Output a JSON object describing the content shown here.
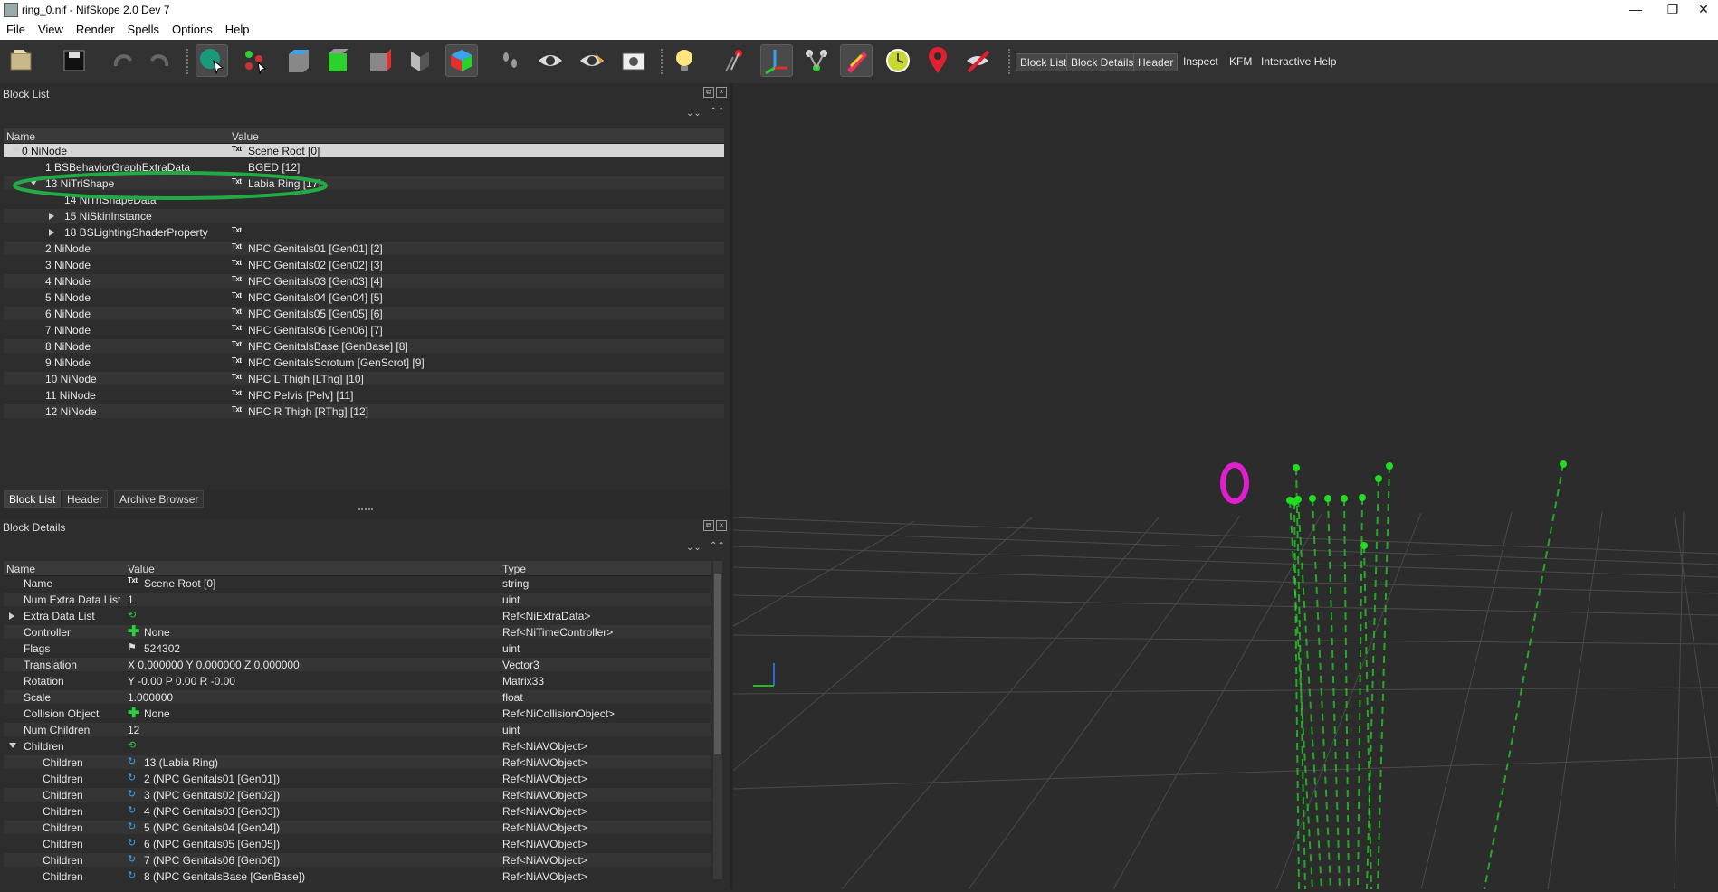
{
  "window": {
    "title": "ring_0.nif - NifSkope 2.0 Dev 7",
    "controls": [
      "—",
      "❐",
      "✕"
    ]
  },
  "menu": [
    "File",
    "View",
    "Render",
    "Spells",
    "Options",
    "Help"
  ],
  "toolbar": {
    "text_buttons": [
      "Block List",
      "Block Details",
      "Header",
      "Inspect",
      "KFM",
      "Interactive Help"
    ]
  },
  "block_list": {
    "title": "Block List",
    "columns": [
      "Name",
      "Value"
    ],
    "rows": [
      {
        "name": "0 NiNode",
        "value": "Scene Root [0]"
      },
      {
        "name": "1 BSBehaviorGraphExtraData",
        "value": "BGED [12]"
      },
      {
        "name": "13 NiTriShape",
        "value": "Labia Ring [17]"
      },
      {
        "name": "14 NiTriShapeData",
        "value": ""
      },
      {
        "name": "15 NiSkinInstance",
        "value": ""
      },
      {
        "name": "18 BSLightingShaderProperty",
        "value": ""
      },
      {
        "name": "2 NiNode",
        "value": "NPC Genitals01 [Gen01] [2]"
      },
      {
        "name": "3 NiNode",
        "value": "NPC Genitals02 [Gen02] [3]"
      },
      {
        "name": "4 NiNode",
        "value": "NPC Genitals03 [Gen03] [4]"
      },
      {
        "name": "5 NiNode",
        "value": "NPC Genitals04 [Gen04] [5]"
      },
      {
        "name": "6 NiNode",
        "value": "NPC Genitals05 [Gen05] [6]"
      },
      {
        "name": "7 NiNode",
        "value": "NPC Genitals06 [Gen06] [7]"
      },
      {
        "name": "8 NiNode",
        "value": "NPC GenitalsBase [GenBase] [8]"
      },
      {
        "name": "9 NiNode",
        "value": "NPC GenitalsScrotum [GenScrot] [9]"
      },
      {
        "name": "10 NiNode",
        "value": "NPC L Thigh [LThg] [10]"
      },
      {
        "name": "11 NiNode",
        "value": "NPC Pelvis [Pelv] [11]"
      },
      {
        "name": "12 NiNode",
        "value": "NPC R Thigh [RThg] [12]"
      }
    ],
    "tabs": [
      "Block List",
      "Header",
      "Archive Browser"
    ]
  },
  "block_details": {
    "title": "Block Details",
    "columns": [
      "Name",
      "Value",
      "Type"
    ],
    "rows": [
      {
        "name": "Name",
        "value": "Scene Root [0]",
        "type": "string"
      },
      {
        "name": "Num Extra Data List",
        "value": "1",
        "type": "uint"
      },
      {
        "name": "Extra Data List",
        "value": "",
        "type": "Ref<NiExtraData>"
      },
      {
        "name": "Controller",
        "value": "None",
        "type": "Ref<NiTimeController>"
      },
      {
        "name": "Flags",
        "value": "524302",
        "type": "uint"
      },
      {
        "name": "Translation",
        "value": "X 0.000000 Y 0.000000 Z 0.000000",
        "type": "Vector3"
      },
      {
        "name": "Rotation",
        "value": "Y -0.00 P 0.00 R -0.00",
        "type": "Matrix33"
      },
      {
        "name": "Scale",
        "value": "1.000000",
        "type": "float"
      },
      {
        "name": "Collision Object",
        "value": "None",
        "type": "Ref<NiCollisionObject>"
      },
      {
        "name": "Num Children",
        "value": "12",
        "type": "uint"
      },
      {
        "name": "Children",
        "value": "",
        "type": "Ref<NiAVObject>"
      },
      {
        "name": "Children",
        "value": "13 (Labia Ring)",
        "type": "Ref<NiAVObject>"
      },
      {
        "name": "Children",
        "value": "2 (NPC Genitals01 [Gen01])",
        "type": "Ref<NiAVObject>"
      },
      {
        "name": "Children",
        "value": "3 (NPC Genitals02 [Gen02])",
        "type": "Ref<NiAVObject>"
      },
      {
        "name": "Children",
        "value": "4 (NPC Genitals03 [Gen03])",
        "type": "Ref<NiAVObject>"
      },
      {
        "name": "Children",
        "value": "5 (NPC Genitals04 [Gen04])",
        "type": "Ref<NiAVObject>"
      },
      {
        "name": "Children",
        "value": "6 (NPC Genitals05 [Gen05])",
        "type": "Ref<NiAVObject>"
      },
      {
        "name": "Children",
        "value": "7 (NPC Genitals06 [Gen06])",
        "type": "Ref<NiAVObject>"
      },
      {
        "name": "Children",
        "value": "8 (NPC GenitalsBase [GenBase])",
        "type": "Ref<NiAVObject>"
      }
    ]
  },
  "colors": {
    "highlight_ring": "#22aa44",
    "ring_mesh": "#e020d0",
    "bone_nodes": "#22dd22"
  }
}
